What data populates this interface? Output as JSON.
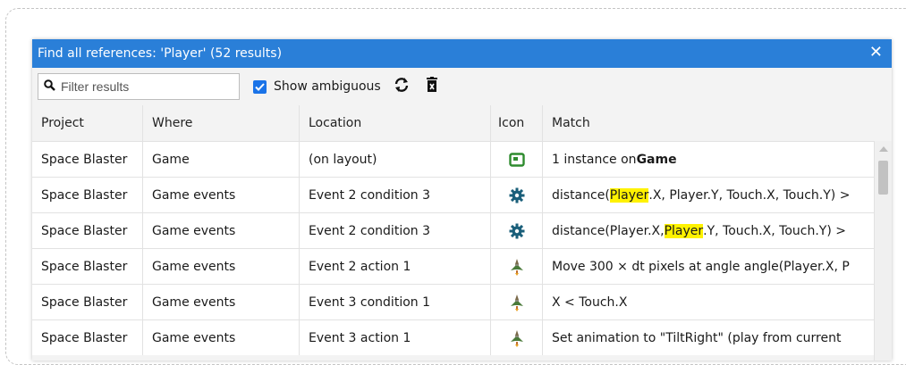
{
  "dialog": {
    "title": "Find all references: 'Player' (52 results)",
    "close_glyph": "✕"
  },
  "toolbar": {
    "filter_placeholder": "Filter results",
    "show_ambiguous_label": "Show ambiguous",
    "show_ambiguous_checked": true
  },
  "columns": [
    "Project",
    "Where",
    "Location",
    "Icon",
    "Match"
  ],
  "rows": [
    {
      "project": "Space Blaster",
      "where": "Game",
      "location": "(on layout)",
      "icon": "layout-instance-icon",
      "match": [
        {
          "t": "1 instance on "
        },
        {
          "t": "Game",
          "b": true
        }
      ]
    },
    {
      "project": "Space Blaster",
      "where": "Game events",
      "location": "Event 2 condition 3",
      "icon": "gear-icon",
      "match": [
        {
          "t": "distance("
        },
        {
          "t": "Player",
          "h": true
        },
        {
          "t": ".X, Player.Y, Touch.X, Touch.Y) >"
        }
      ]
    },
    {
      "project": "Space Blaster",
      "where": "Game events",
      "location": "Event 2 condition 3",
      "icon": "gear-icon",
      "match": [
        {
          "t": "distance(Player.X, "
        },
        {
          "t": "Player",
          "h": true
        },
        {
          "t": ".Y, Touch.X, Touch.Y) >"
        }
      ]
    },
    {
      "project": "Space Blaster",
      "where": "Game events",
      "location": "Event 2 action 1",
      "icon": "player-sprite-icon",
      "match": [
        {
          "t": "Move 300 × dt pixels at angle angle(Player.X, P"
        }
      ]
    },
    {
      "project": "Space Blaster",
      "where": "Game events",
      "location": "Event 3 condition 1",
      "icon": "player-sprite-icon",
      "match": [
        {
          "t": "X < Touch.X"
        }
      ]
    },
    {
      "project": "Space Blaster",
      "where": "Game events",
      "location": "Event 3 action 1",
      "icon": "player-sprite-icon",
      "match": [
        {
          "t": "Set animation to \"TiltRight\" (play from current"
        }
      ]
    }
  ],
  "colors": {
    "titlebar": "#2a7fd8",
    "highlight": "#fff200",
    "gear": "#1a5f7a",
    "layout_icon": "#2e8b2e"
  }
}
